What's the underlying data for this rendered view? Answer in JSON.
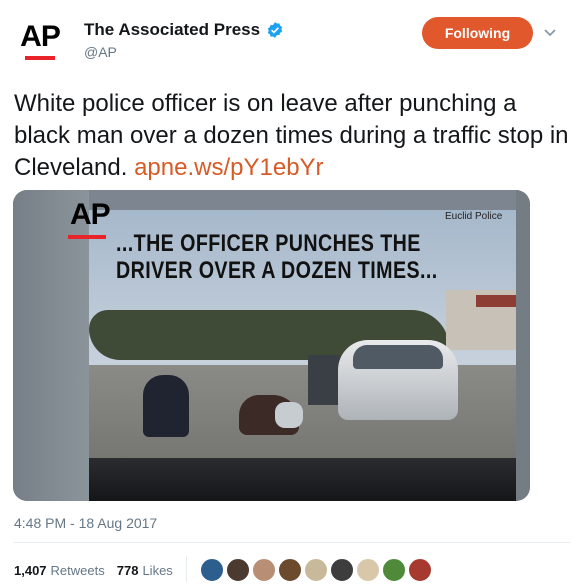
{
  "tweet": {
    "display_name": "The Associated Press",
    "handle": "@AP",
    "verified": true,
    "avatar_text": "AP",
    "follow_button_label": "Following",
    "text_main": "White police officer is on leave after punching a black man over a dozen times during a traffic stop in Cleveland.",
    "text_link": "apne.ws/pY1ebYr",
    "timestamp": "4:48 PM - 18 Aug 2017",
    "retweets_count": "1,407",
    "retweets_label": "Retweets",
    "likes_count": "778",
    "likes_label": "Likes"
  },
  "media": {
    "logo_text": "AP",
    "credit": "Euclid Police",
    "caption": "...THE OFFICER PUNCHES THE DRIVER OVER A DOZEN TIMES..."
  },
  "likers": [
    {
      "icon": "avatar-1",
      "color": "#2d5f8e"
    },
    {
      "icon": "avatar-2",
      "color": "#4a3a30"
    },
    {
      "icon": "avatar-3",
      "color": "#b88e74"
    },
    {
      "icon": "avatar-4",
      "color": "#6b4a2e"
    },
    {
      "icon": "avatar-5",
      "color": "#c8b99a"
    },
    {
      "icon": "avatar-6",
      "color": "#3d3d3d"
    },
    {
      "icon": "avatar-7",
      "color": "#d9c7a9"
    },
    {
      "icon": "avatar-8",
      "color": "#4e8a3a"
    },
    {
      "icon": "avatar-9",
      "color": "#a63a2e"
    }
  ],
  "colors": {
    "accent": "#e0582b",
    "link": "#d75b26",
    "verified": "#1da1f2",
    "ap_red": "#e8232a"
  }
}
